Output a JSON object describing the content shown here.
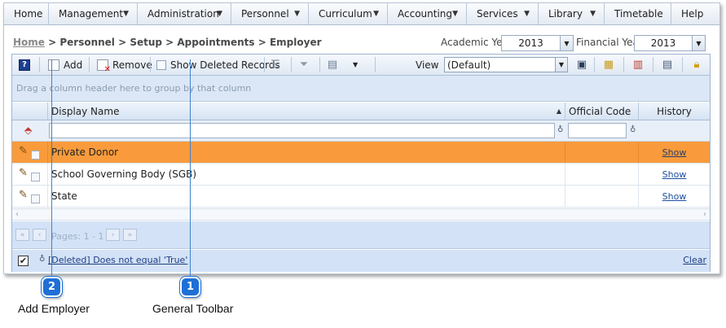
{
  "menu": {
    "items": [
      {
        "label": "Home",
        "dropdown": false
      },
      {
        "label": "Management",
        "dropdown": true
      },
      {
        "label": "Administration",
        "dropdown": true
      },
      {
        "label": "Personnel",
        "dropdown": true
      },
      {
        "label": "Curriculum",
        "dropdown": true
      },
      {
        "label": "Accounting",
        "dropdown": true
      },
      {
        "label": "Services",
        "dropdown": true
      },
      {
        "label": "Library",
        "dropdown": true
      },
      {
        "label": "Timetable",
        "dropdown": false
      },
      {
        "label": "Help",
        "dropdown": false
      }
    ]
  },
  "breadcrumb": {
    "home": "Home",
    "path": " > Personnel > Setup > Appointments > Employer"
  },
  "academic_year": {
    "label": "Academic Year",
    "value": "2013"
  },
  "financial_year": {
    "label": "Financial Year",
    "value": "2013"
  },
  "toolbar": {
    "help_glyph": "?",
    "add_label": "Add",
    "remove_label": "Remove",
    "show_deleted_label": "Show Deleted Records",
    "view_label": "View",
    "view_value": "(Default)"
  },
  "grid": {
    "group_hint": "Drag a column header here to group by that column",
    "columns": {
      "display_name": "Display Name",
      "official_code": "Official Code",
      "history": "History"
    },
    "rows": [
      {
        "display_name": "Private Donor",
        "official_code": "",
        "history": "Show",
        "selected": true
      },
      {
        "display_name": "School Governing Body (SGB)",
        "official_code": "",
        "history": "Show",
        "selected": false
      },
      {
        "display_name": "State",
        "official_code": "",
        "history": "Show",
        "selected": false
      }
    ],
    "pager_text": "Pages: 1 - 1",
    "filter_expression": "[Deleted] Does not equal 'True'",
    "clear_label": "Clear"
  },
  "callouts": [
    {
      "number": "1",
      "caption": "General Toolbar"
    },
    {
      "number": "2",
      "caption": "Add Employer"
    }
  ],
  "colors": {
    "selected_row": "#f99b3c",
    "callout": "#1e6fd6",
    "link": "#1f4fa0"
  }
}
